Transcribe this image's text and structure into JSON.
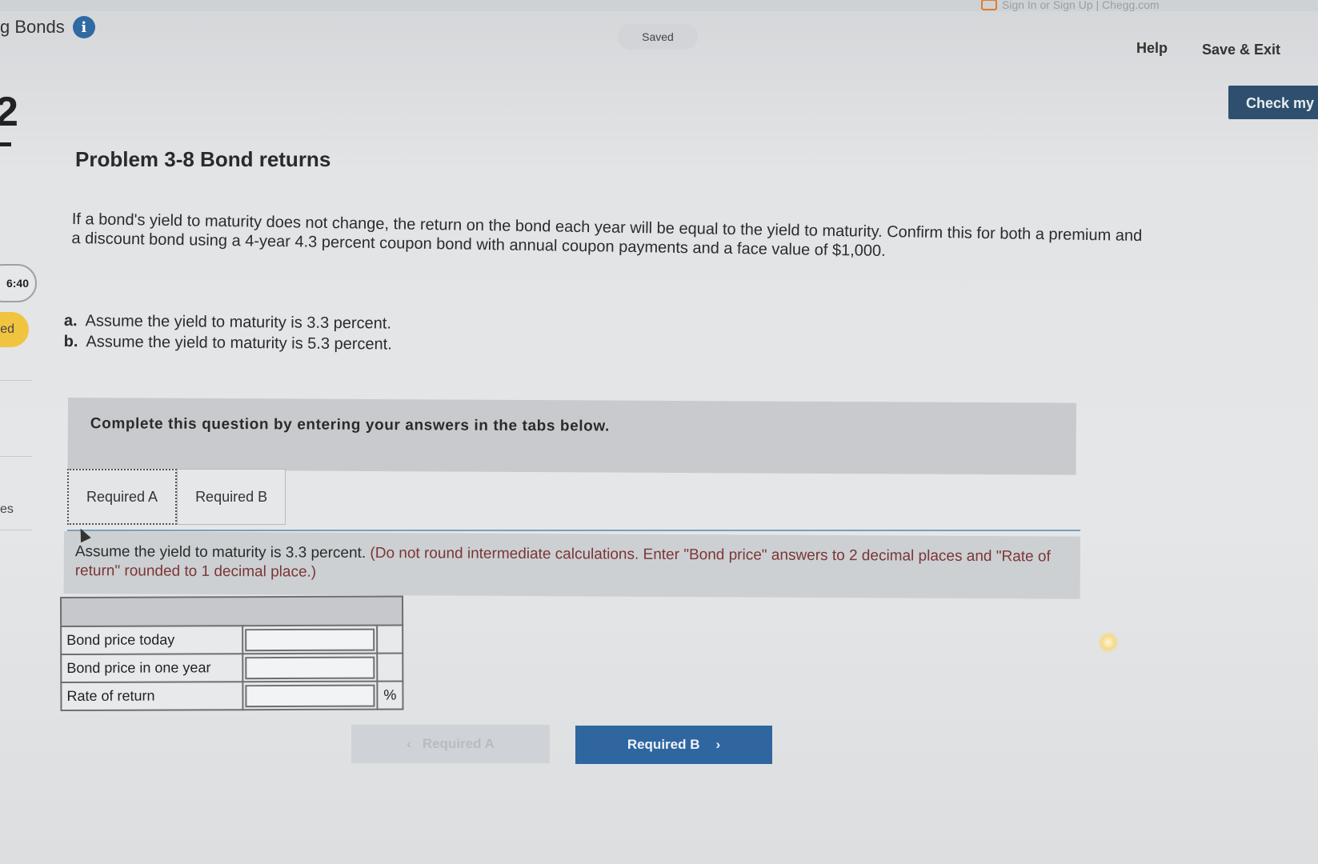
{
  "header": {
    "chegg_link": "Sign In or Sign Up | Chegg.com",
    "app_title": "g Bonds",
    "saved_label": "Saved",
    "help_label": "Help",
    "save_exit_label": "Save & Exit",
    "check_label": "Check my"
  },
  "sidebar": {
    "question_number": "2",
    "timer": "6:40",
    "status": "ed",
    "item_es": "es"
  },
  "problem": {
    "title": "Problem 3-8 Bond returns",
    "text": "If a bond's yield to maturity does not change, the return on the bond each year will be equal to the yield to maturity. Confirm this for both a premium and a discount bond using a 4-year 4.3 percent coupon bond with annual coupon payments and a face value of $1,000.",
    "parts": [
      {
        "label": "a.",
        "text": "Assume the yield to maturity is 3.3 percent."
      },
      {
        "label": "b.",
        "text": "Assume the yield to maturity is 5.3 percent."
      }
    ]
  },
  "instruction": "Complete this question by entering your answers in the tabs below.",
  "tabs": [
    {
      "label": "Required A",
      "active": true
    },
    {
      "label": "Required B",
      "active": false
    }
  ],
  "question": {
    "main": "Assume the yield to maturity is 3.3 percent.",
    "note": "(Do not round intermediate calculations. Enter \"Bond price\" answers to 2 decimal places and \"Rate of return\" rounded to 1 decimal place.)"
  },
  "table": {
    "rows": [
      {
        "label": "Bond price today",
        "value": "",
        "unit": ""
      },
      {
        "label": "Bond price in one year",
        "value": "",
        "unit": ""
      },
      {
        "label": "Rate of return",
        "value": "",
        "unit": "%"
      }
    ]
  },
  "nav": {
    "prev_label": "Required A",
    "next_label": "Required B"
  },
  "colors": {
    "primary_button": "#2f66a0",
    "check_button": "#2f4f6e",
    "status_yellow": "#f0c43e",
    "note_text": "#7c3535"
  }
}
